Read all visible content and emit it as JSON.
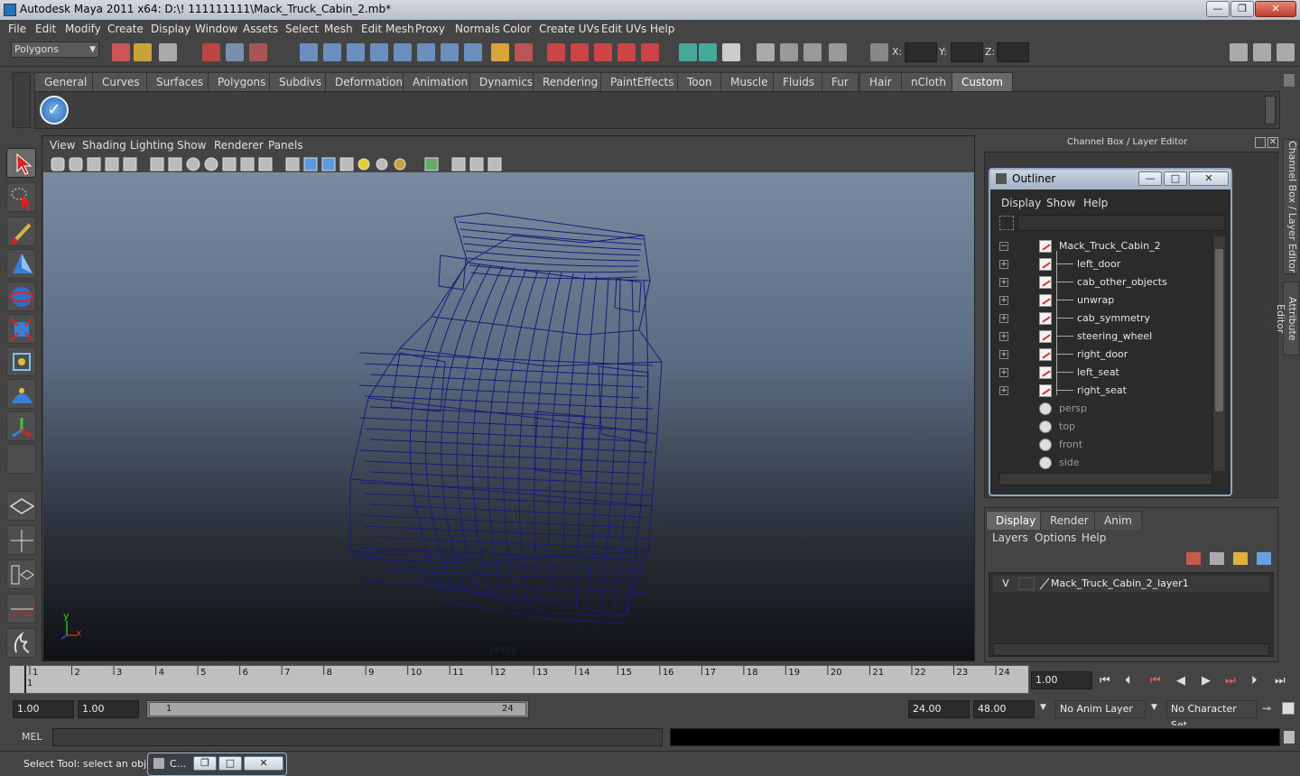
{
  "window": {
    "title": "Autodesk Maya 2011 x64: D:\\! 111111111\\Mack_Truck_Cabin_2.mb*",
    "minimize": "—",
    "restore": "❐",
    "close": "✕"
  },
  "menubar": [
    "File",
    "Edit",
    "Modify",
    "Create",
    "Display",
    "Window",
    "Assets",
    "Select",
    "Mesh",
    "Edit Mesh",
    "Proxy",
    "Normals",
    "Color",
    "Create UVs",
    "Edit UVs",
    "Help"
  ],
  "statusline": {
    "mode": "Polygons",
    "x_label": "X:",
    "y_label": "Y:",
    "z_label": "Z:"
  },
  "shelf": {
    "tabs": [
      "General",
      "Curves",
      "Surfaces",
      "Polygons",
      "Subdivs",
      "Deformation",
      "Animation",
      "Dynamics",
      "Rendering",
      "PaintEffects",
      "Toon",
      "Muscle",
      "Fluids",
      "Fur",
      "Hair",
      "nCloth",
      "Custom"
    ],
    "active_tab": "Custom"
  },
  "viewport": {
    "menus": [
      "View",
      "Shading",
      "Lighting",
      "Show",
      "Renderer",
      "Panels"
    ],
    "camera_label": "persp",
    "axis_y": "y",
    "axis_x": "x",
    "wire_color": "#1a1a7a"
  },
  "channel_box": {
    "title": "Channel Box / Layer Editor",
    "side_tab_1": "Channel Box / Layer Editor",
    "side_tab_2": "Attribute Editor"
  },
  "outliner": {
    "title": "Outliner",
    "menus": [
      "Display",
      "Show",
      "Help"
    ],
    "items": [
      {
        "label": "Mack_Truck_Cabin_2",
        "kind": "mesh",
        "level": 0,
        "expander": "−"
      },
      {
        "label": "left_door",
        "kind": "mesh",
        "level": 1,
        "expander": "+"
      },
      {
        "label": "cab_other_objects",
        "kind": "mesh",
        "level": 1,
        "expander": "+"
      },
      {
        "label": "unwrap",
        "kind": "mesh",
        "level": 1,
        "expander": "+"
      },
      {
        "label": "cab_symmetry",
        "kind": "mesh",
        "level": 1,
        "expander": "+"
      },
      {
        "label": "steering_wheel",
        "kind": "mesh",
        "level": 1,
        "expander": "+"
      },
      {
        "label": "right_door",
        "kind": "mesh",
        "level": 1,
        "expander": "+"
      },
      {
        "label": "left_seat",
        "kind": "mesh",
        "level": 1,
        "expander": "+"
      },
      {
        "label": "right_seat",
        "kind": "mesh",
        "level": 1,
        "expander": "+"
      },
      {
        "label": "persp",
        "kind": "camera",
        "level": 0,
        "expander": ""
      },
      {
        "label": "top",
        "kind": "camera",
        "level": 0,
        "expander": ""
      },
      {
        "label": "front",
        "kind": "camera",
        "level": 0,
        "expander": ""
      },
      {
        "label": "side",
        "kind": "camera",
        "level": 0,
        "expander": ""
      }
    ]
  },
  "layer_editor": {
    "tabs": [
      "Display",
      "Render",
      "Anim"
    ],
    "active_tab": "Display",
    "menus": [
      "Layers",
      "Options",
      "Help"
    ],
    "layer": {
      "visibility": "V",
      "name": "Mack_Truck_Cabin_2_layer1"
    }
  },
  "timeline": {
    "ticks": [
      "1",
      "2",
      "3",
      "4",
      "5",
      "6",
      "7",
      "8",
      "9",
      "10",
      "11",
      "12",
      "13",
      "14",
      "15",
      "16",
      "17",
      "18",
      "19",
      "20",
      "21",
      "22",
      "23",
      "24"
    ],
    "current_frame_label": "1",
    "current_time": "1.00"
  },
  "range": {
    "start_time": "1.00",
    "playback_start": "1.00",
    "range_start": "1",
    "range_end": "24",
    "playback_end": "24.00",
    "end_time": "48.00",
    "anim_layer": "No Anim Layer",
    "character_set": "No Character Set"
  },
  "command_line": {
    "label": "MEL"
  },
  "help_line": {
    "text": "Select Tool: select an object",
    "minimized_window": "C..."
  }
}
